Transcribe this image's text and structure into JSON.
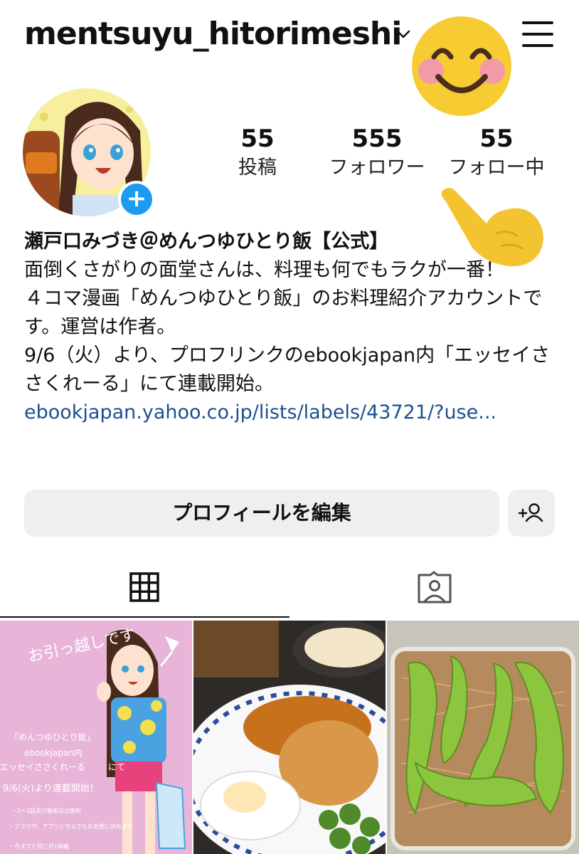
{
  "header": {
    "username": "mentsuyu_hitorimeshi",
    "dropdown_icon": "chevron-down-icon",
    "menu_icon": "hamburger-menu-icon"
  },
  "profile": {
    "avatar_icon": "anime-girl-avatar",
    "add_story_label": "+"
  },
  "stats": [
    {
      "value": "55",
      "label": "投稿"
    },
    {
      "value": "555",
      "label": "フォロワー"
    },
    {
      "value": "55",
      "label": "フォロー中"
    }
  ],
  "bio": {
    "name": "瀬戸口みづき＠めんつゆひとり飯【公式】",
    "text": "面倒くさがりの面堂さんは、料理も何でもラクが一番！\n４コマ漫画「めんつゆひとり飯」のお料理紹介アカウントです。運営は作者。\n9/6（火）より、プロフリンクのebookjapan内「エッセイささくれーる」にて連載開始。",
    "link": "ebookjapan.yahoo.co.jp/lists/labels/43721/?use..."
  },
  "buttons": {
    "edit_profile": "プロフィールを編集",
    "add_friend_icon": "add-person-icon"
  },
  "tabs": [
    {
      "icon": "grid-icon",
      "active": true
    },
    {
      "icon": "tagged-person-icon",
      "active": false
    }
  ],
  "posts": [
    {
      "type": "illustration",
      "texts": [
        "お引っ越しです",
        "「めんつゆひとり飯」",
        "ebookjapan内",
        "エッセイささくれーる",
        "にて",
        "9/6(火)より連載開始！",
        "・1〜3話及び最新話は無料",
        "・ブラウザ、アプリどちらでもお気軽に読めます",
        "・今までと同じ月1掲載"
      ]
    },
    {
      "type": "photo",
      "subject": "hamburg-steak-with-egg"
    },
    {
      "type": "photo",
      "subject": "shishito-peppers-bonito"
    }
  ],
  "overlays": {
    "smile_emoji": "smiling-face-emoji",
    "pointing_hand": "pointing-hand-emoji"
  },
  "colors": {
    "link": "#1d4f91",
    "button_bg": "#efefef",
    "badge": "#1d9bf0"
  }
}
